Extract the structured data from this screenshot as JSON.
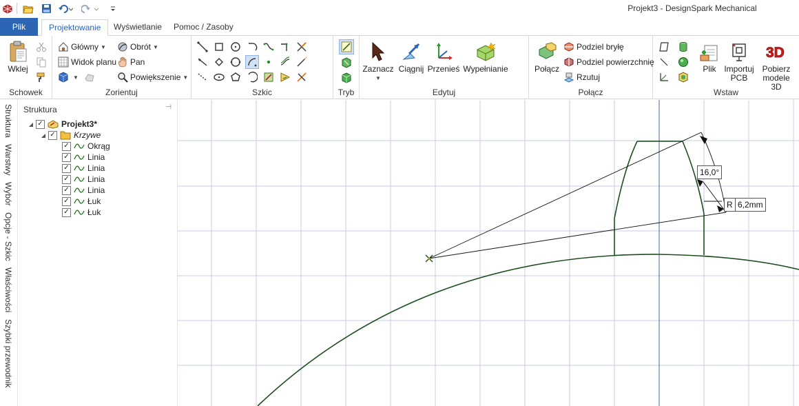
{
  "window": {
    "title": "Projekt3 - DesignSpark Mechanical"
  },
  "quick_access": {
    "icons": [
      "app-icon",
      "open-icon",
      "save-icon",
      "undo-icon",
      "redo-icon",
      "customize-icon"
    ]
  },
  "tabs": [
    {
      "label": "Plik"
    },
    {
      "label": "Projektowanie"
    },
    {
      "label": "Wyświetlanie"
    },
    {
      "label": "Pomoc / Zasoby"
    }
  ],
  "ribbon": {
    "clipboard": {
      "label": "Schowek",
      "paste": "Wklej"
    },
    "orient": {
      "label": "Zorientuj",
      "home": "Główny",
      "plan_view": "Widok planu",
      "rotate": "Obrót",
      "pan": "Pan",
      "zoom": "Powiększenie"
    },
    "sketch": {
      "label": "Szkic"
    },
    "mode": {
      "label": "Tryb"
    },
    "edit": {
      "label": "Edytuj",
      "select": "Zaznacz",
      "pull": "Ciągnij",
      "move": "Przenieś",
      "fill": "Wypełnianie"
    },
    "combine": {
      "label": "Połącz",
      "combine_btn": "Połącz",
      "split_body": "Podziel bryłę",
      "split_face": "Podziel powierzchnię",
      "project": "Rzutuj"
    },
    "insert": {
      "label": "Wstaw",
      "file": "Plik",
      "import_pcb_1": "Importuj",
      "import_pcb_2": "PCB",
      "download_1": "Pobierz",
      "download_2": "modele 3D"
    }
  },
  "side_tabs": [
    "Struktura",
    "Warstwy",
    "Wybór",
    "Opcje - Szkic",
    "Właściwości",
    "Szybki przewodnik"
  ],
  "structure": {
    "header": "Struktura",
    "root": "Projekt3*",
    "folder": "Krzywe",
    "items": [
      "Okrąg",
      "Linia",
      "Linia",
      "Linia",
      "Linia",
      "Łuk",
      "Łuk"
    ]
  },
  "dimensions": {
    "angle": "16,0°",
    "radius_prefix": "R",
    "radius": "6,2mm"
  },
  "colors": {
    "accent": "#2d65b5",
    "curve": "#1e4d1e",
    "grid": "#c7cbe0"
  }
}
